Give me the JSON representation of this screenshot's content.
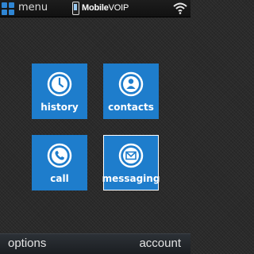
{
  "statusbar": {
    "menu_label": "menu",
    "brand_bold": "Mobile",
    "brand_rest": "VOIP",
    "icons": [
      "menu-grid-icon",
      "phone-icon",
      "wifi-signal-icon"
    ]
  },
  "tiles": [
    {
      "label": "history",
      "icon": "clock-icon",
      "selected": false
    },
    {
      "label": "contacts",
      "icon": "person-icon",
      "selected": false
    },
    {
      "label": "call",
      "icon": "phone-handset-icon",
      "selected": false
    },
    {
      "label": "messaging",
      "icon": "envelope-icon",
      "selected": true
    }
  ],
  "softkeys": {
    "left": "options",
    "right": "account"
  },
  "colors": {
    "tile": "#1e7dcc",
    "accent": "#2f86d4",
    "background": "#2a2a2a"
  }
}
